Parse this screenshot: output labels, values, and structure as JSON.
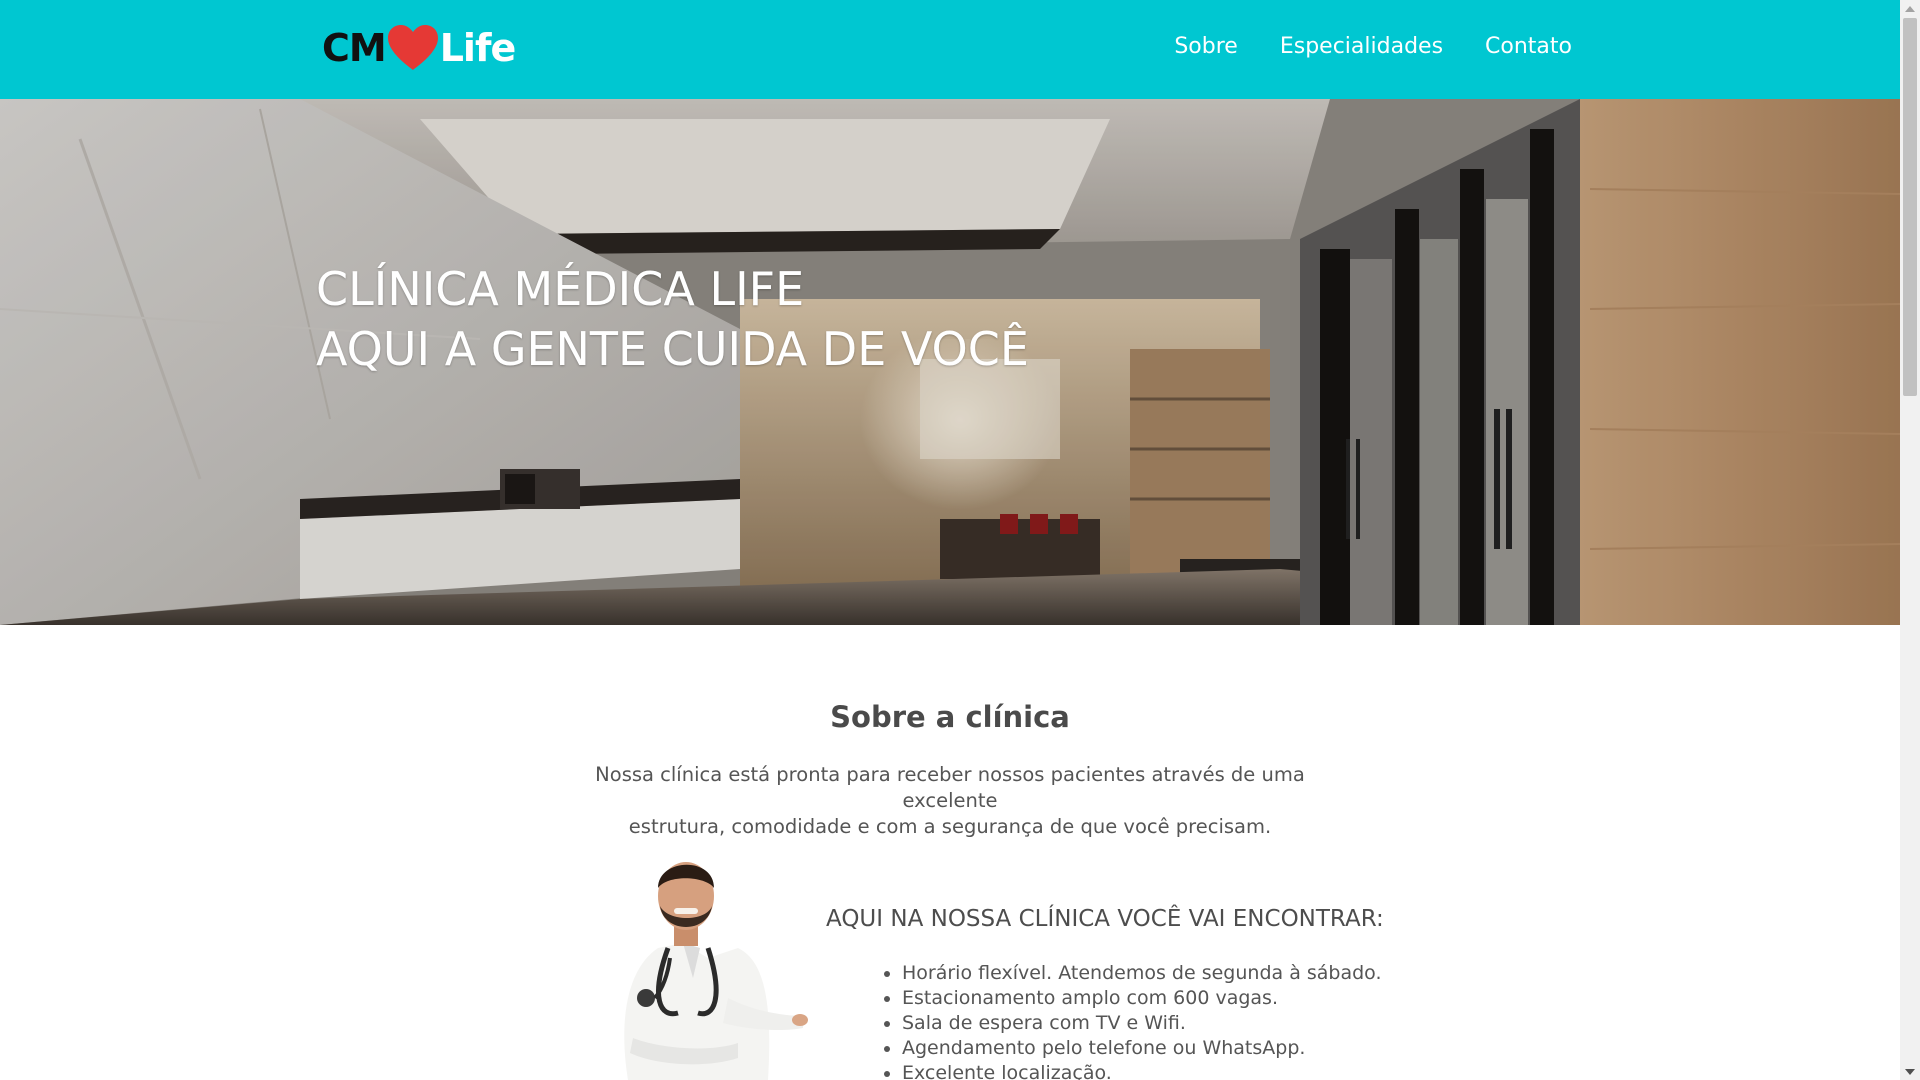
{
  "header": {
    "logo": {
      "left_text": "CM",
      "right_text": "Life",
      "heart_color": "#e53935",
      "icon": "heart-icon"
    },
    "nav": [
      {
        "label": "Sobre"
      },
      {
        "label": "Especialidades"
      },
      {
        "label": "Contato"
      }
    ],
    "background_color": "#00c7d1"
  },
  "hero": {
    "line1": "CLÍNICA MÉDICA LIFE",
    "line2": "AQUI A GENTE CUIDA DE VOCÊ"
  },
  "about": {
    "title": "Sobre a clínica",
    "description_line1": "Nossa clínica está pronta para receber nossos pacientes através de uma excelente",
    "description_line2": "estrutura, comodidade e com a segurança de que você precisam.",
    "features_heading": "AQUI NA NOSSA CLÍNICA VOCÊ VAI ENCONTRAR:",
    "features": [
      "Horário flexível. Atendemos de segunda à sábado.",
      "Estacionamento amplo com 600 vagas.",
      "Sala de espera com TV e Wifi.",
      "Agendamento pelo telefone ou WhatsApp.",
      "Excelente localização."
    ]
  }
}
